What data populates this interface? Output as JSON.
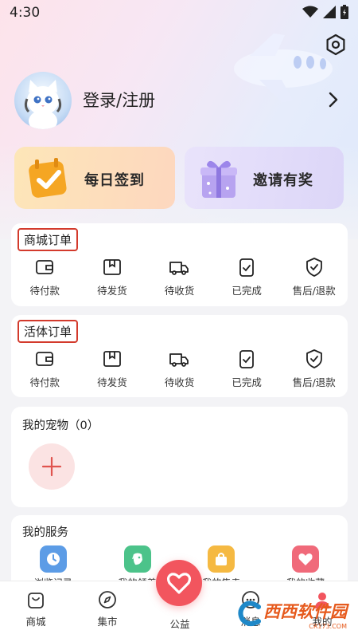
{
  "status_bar": {
    "time": "4:30"
  },
  "profile": {
    "login_label": "登录/注册"
  },
  "promos": {
    "checkin_label": "每日签到",
    "invite_label": "邀请有奖"
  },
  "mall_orders": {
    "title": "商城订单",
    "items": [
      "待付款",
      "待发货",
      "待收货",
      "已完成",
      "售后/退款"
    ]
  },
  "live_orders": {
    "title": "活体订单",
    "items": [
      "待付款",
      "待发货",
      "待收货",
      "已完成",
      "售后/退款"
    ]
  },
  "pets": {
    "title": "我的宠物（0）"
  },
  "services": {
    "title": "我的服务",
    "items": [
      {
        "label": "浏览记录",
        "icon": "clock-icon",
        "color": "#5c9ce6"
      },
      {
        "label": "我的领养",
        "icon": "dog-icon",
        "color": "#4cc38a"
      },
      {
        "label": "我的售卖",
        "icon": "bag-icon",
        "color": "#f5b942"
      },
      {
        "label": "我的收藏",
        "icon": "heart-icon",
        "color": "#f06a7a"
      }
    ]
  },
  "bottom_nav": {
    "items": [
      "商城",
      "集市",
      "公益",
      "消息",
      "我的"
    ]
  },
  "watermark": {
    "text": "西西软件园",
    "sub": "CR173.COM"
  },
  "colors": {
    "accent": "#f2555e",
    "highlight_border": "#d33a2c"
  }
}
